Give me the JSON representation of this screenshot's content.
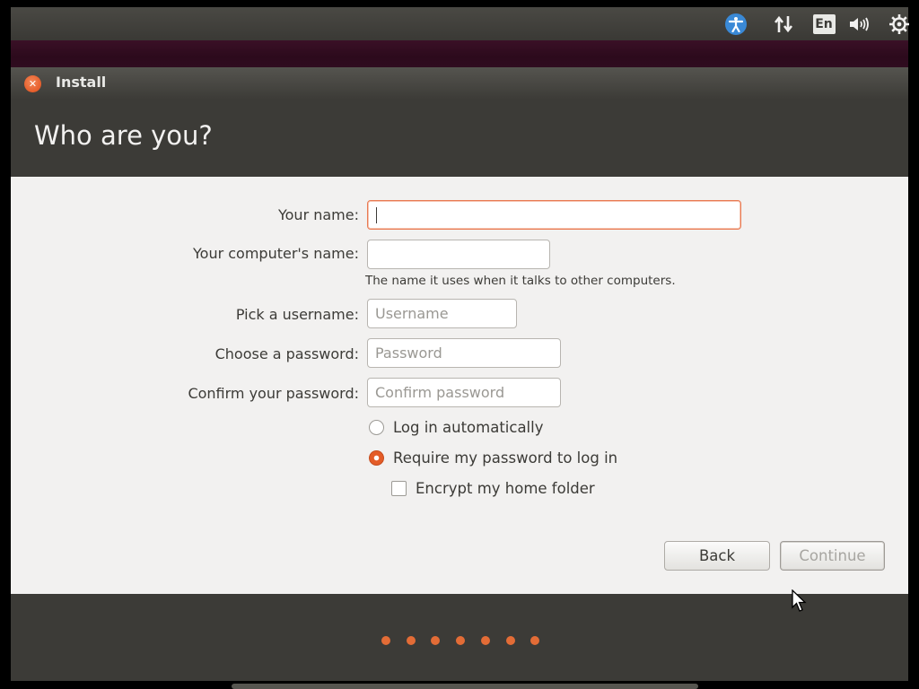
{
  "panel": {
    "accessibility_icon": "accessibility-icon",
    "network_icon": "network-arrows-icon",
    "keyboard_language": "En",
    "volume_icon": "volume-icon",
    "power_icon": "gear-power-icon"
  },
  "window": {
    "title": "Install",
    "close_icon": "close-icon",
    "heading": "Who are you?"
  },
  "form": {
    "name_label": "Your name:",
    "name_value": "",
    "computer_label": "Your computer's name:",
    "computer_value": "",
    "computer_hint": "The name it uses when it talks to other computers.",
    "username_label": "Pick a username:",
    "username_placeholder": "Username",
    "password_label": "Choose a password:",
    "password_placeholder": "Password",
    "confirm_label": "Confirm your password:",
    "confirm_placeholder": "Confirm password",
    "options": [
      {
        "label": "Log in automatically",
        "type": "radio",
        "checked": false
      },
      {
        "label": "Require my password to log in",
        "type": "radio",
        "checked": true
      },
      {
        "label": "Encrypt my home folder",
        "type": "checkbox",
        "checked": false
      }
    ]
  },
  "buttons": {
    "back": "Back",
    "continue": "Continue",
    "continue_enabled": false
  },
  "progress": {
    "total_steps": 7
  },
  "colors": {
    "accent": "#e36c36",
    "panel": "#3c3b37",
    "content_bg": "#f2f1f0"
  }
}
